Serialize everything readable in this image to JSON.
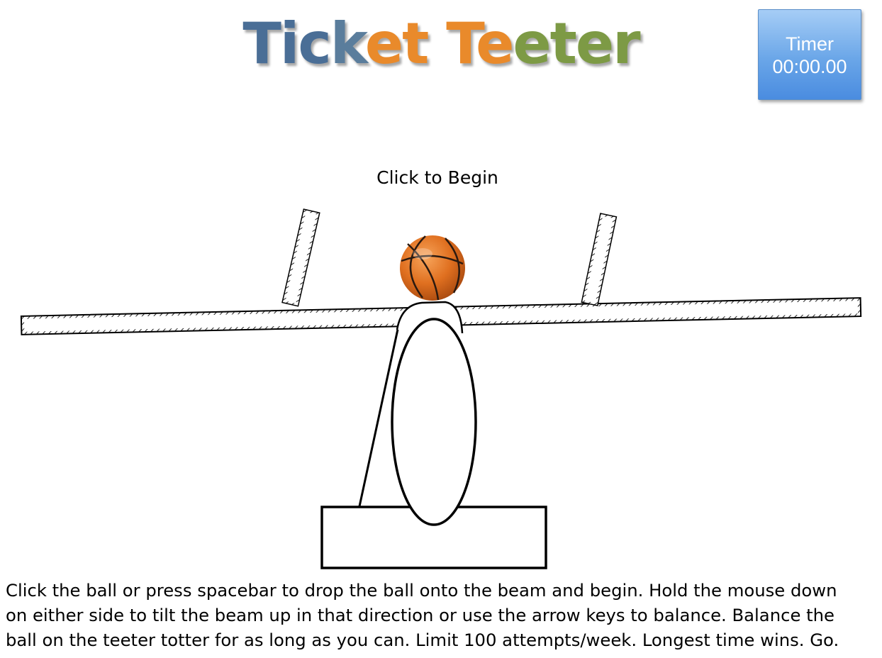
{
  "game": {
    "title_parts": [
      {
        "text": "Tic",
        "color": "#4a6e96"
      },
      {
        "text": "k",
        "color": "#5a7d9c"
      },
      {
        "text": "et ",
        "color": "#e98a2b"
      },
      {
        "text": "T",
        "color": "#e98a2b"
      },
      {
        "text": "e",
        "color": "#e98a2b"
      },
      {
        "text": "eter",
        "color": "#7d9a45"
      }
    ],
    "timer": {
      "label": "Timer",
      "value": "00:00.00"
    },
    "prompt": "Click to Begin",
    "instructions": [
      "Click the ball or press spacebar to drop the ball onto the beam and begin. Hold the mouse down",
      "on either side to tilt the beam up in that direction or use the arrow keys to balance. Balance the",
      "ball on the teeter totter for as long as you can. Limit 100 attempts/week. Longest time wins. Go."
    ]
  },
  "icons": {
    "ball": "basketball-icon"
  },
  "colors": {
    "ball_orange": "#e07020",
    "ball_seams": "#2b1a10",
    "timer_blue": "#6aa6e8",
    "outline": "#000000"
  }
}
